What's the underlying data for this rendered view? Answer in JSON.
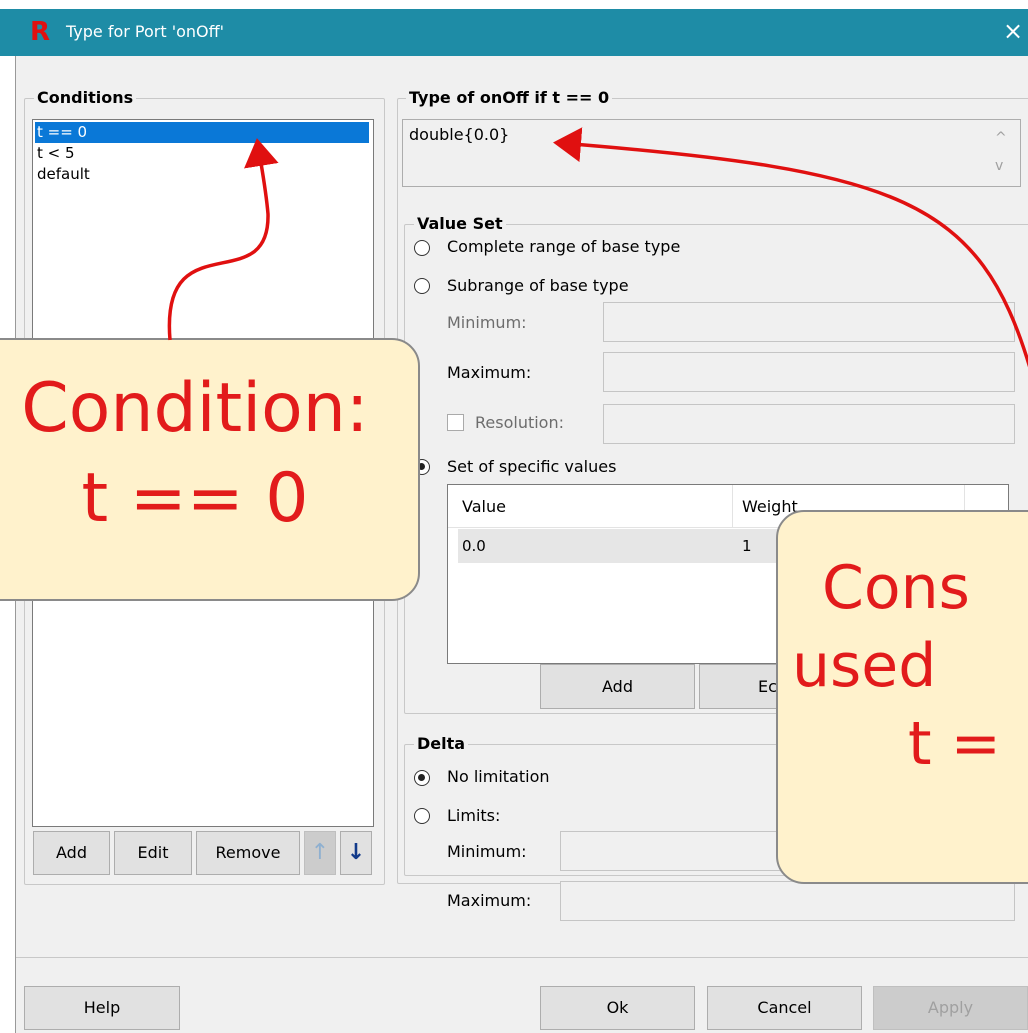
{
  "window": {
    "title": "Type for Port 'onOff'",
    "logo": "R",
    "close_icon": "×"
  },
  "conditions": {
    "title": "Conditions",
    "items": [
      "t == 0",
      "t < 5",
      "default"
    ],
    "selected_index": 0,
    "buttons": {
      "add": "Add",
      "edit": "Edit",
      "remove": "Remove",
      "up_icon": "↑",
      "down_icon": "↓"
    }
  },
  "type_panel": {
    "title": "Type of onOff if t == 0",
    "type_value": "double{0.0}",
    "scroll_up_icon": "^",
    "scroll_down_icon": "v"
  },
  "value_set": {
    "title": "Value Set",
    "complete_range": "Complete range of base type",
    "subrange": "Subrange of base type",
    "minimum": "Minimum:",
    "maximum": "Maximum:",
    "resolution": "Resolution:",
    "specific": "Set of specific values",
    "table": {
      "columns": [
        "Value",
        "Weight"
      ],
      "rows": [
        [
          "0.0",
          "1"
        ]
      ]
    },
    "add_button": "Add",
    "edit_button": "Ec"
  },
  "delta": {
    "title": "Delta",
    "no_limitation": "No limitation",
    "limits": "Limits:",
    "minimum": "Minimum:",
    "maximum": "Maximum:"
  },
  "footer": {
    "help": "Help",
    "ok": "Ok",
    "cancel": "Cancel",
    "apply": "Apply"
  },
  "annotations": {
    "callout_condition": {
      "line1": "Condition:",
      "line2": "t == 0"
    },
    "callout_constraint": {
      "line1": "Cons",
      "line2": "used",
      "line3": "t ="
    },
    "arrow_color": "#e01010",
    "callout_fill": "#fff2cc"
  },
  "colors": {
    "titlebar": "#1e8ca6",
    "selection": "#0a78d7",
    "dialog_bg": "#f0f0f0"
  }
}
